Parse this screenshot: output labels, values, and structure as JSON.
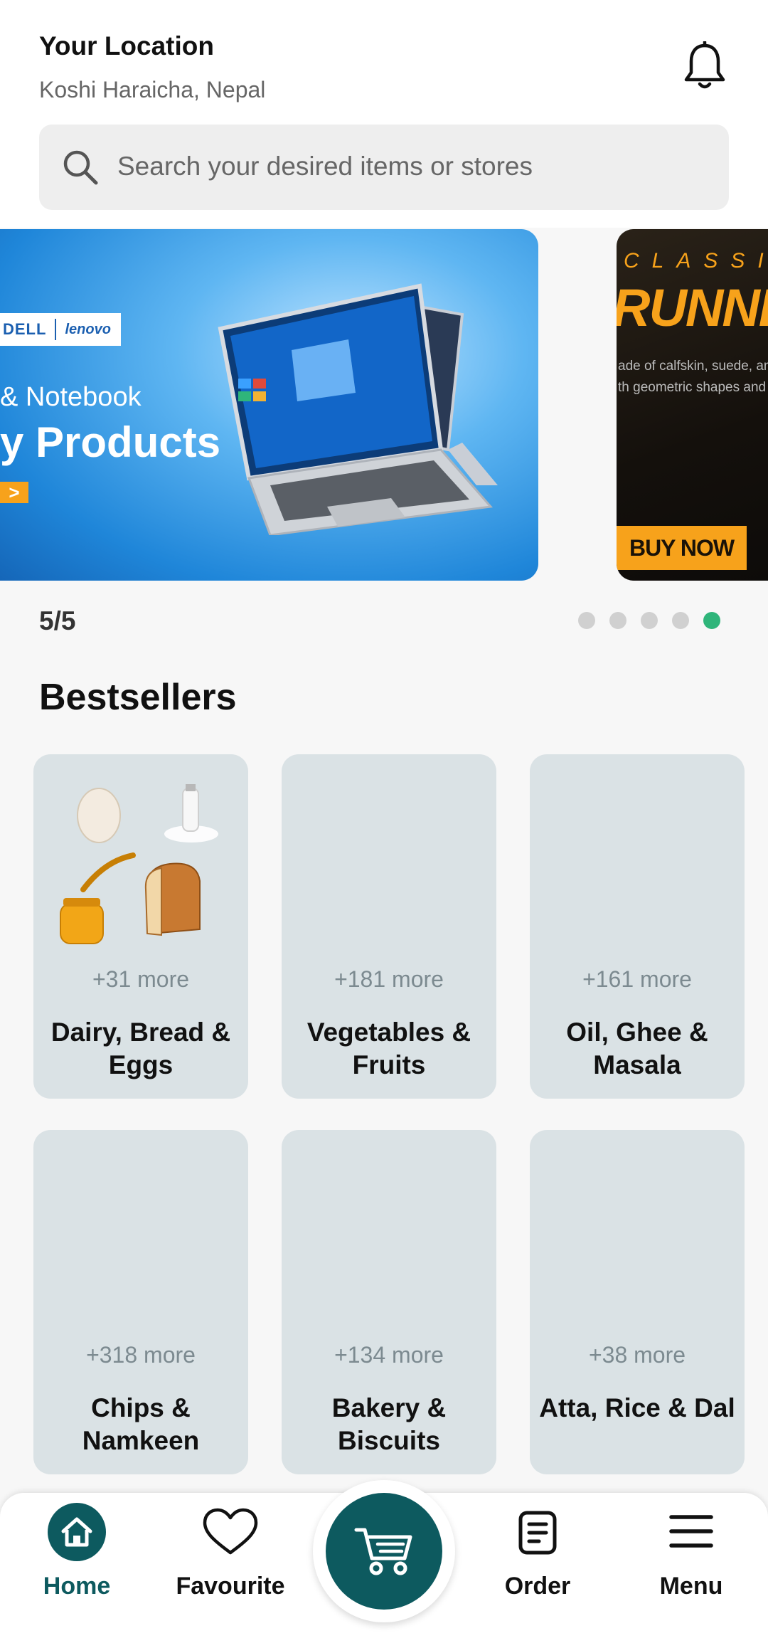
{
  "header": {
    "location_title": "Your Location",
    "location_value": "Koshi Haraicha, Nepal"
  },
  "search": {
    "placeholder": "Search your desired items or stores"
  },
  "carousel": {
    "counter": "5/5",
    "total_dots": 5,
    "active_dot": 5,
    "banners": [
      {
        "brand_1": "DELL",
        "brand_2": "lenovo",
        "line1": "& Notebook",
        "line2": "y Products",
        "arrow": ">"
      },
      {
        "kicker": "CLASSI",
        "headline": "RUNNER S",
        "desc_1": "ade of calfskin, suede, and",
        "desc_2": "th  geometric shapes and t",
        "cta": "BUY NOW"
      }
    ]
  },
  "bestsellers": {
    "title": "Bestsellers",
    "categories": [
      {
        "more": "+31 more",
        "name": "Dairy, Bread & Eggs"
      },
      {
        "more": "+181 more",
        "name": "Vegetables & Fruits"
      },
      {
        "more": "+161 more",
        "name": "Oil, Ghee & Masala"
      },
      {
        "more": "+318 more",
        "name": "Chips & Namkeen"
      },
      {
        "more": "+134 more",
        "name": "Bakery & Biscuits"
      },
      {
        "more": "+38 more",
        "name": "Atta, Rice & Dal"
      }
    ]
  },
  "nav": {
    "home": "Home",
    "favourite": "Favourite",
    "order": "Order",
    "menu": "Menu"
  },
  "colors": {
    "accent": "#0d5a5f",
    "dot_active": "#2fb57a",
    "card_bg": "#dae2e5",
    "banner_orange": "#f7a21b"
  }
}
